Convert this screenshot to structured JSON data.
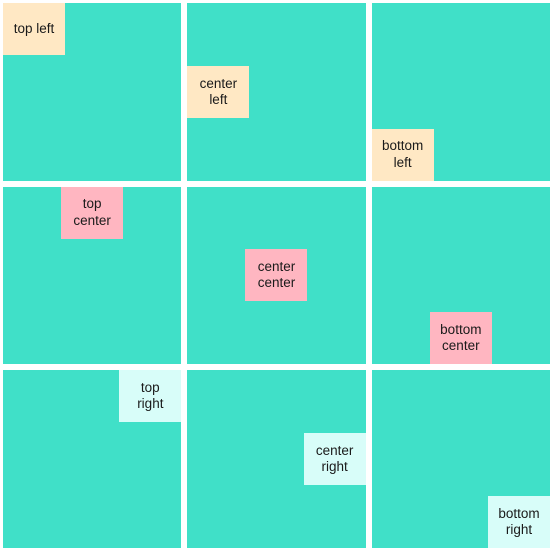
{
  "colors": {
    "grid_bg": "#40e0c8",
    "cream": "#ffe8c4",
    "pink": "#ffb6c1",
    "mint": "#d8fdf9"
  },
  "cells": [
    {
      "label": "top left",
      "color": "cream",
      "align": "c1"
    },
    {
      "label": "center\nleft",
      "color": "cream",
      "align": "c2"
    },
    {
      "label": "bottom\nleft",
      "color": "cream",
      "align": "c3"
    },
    {
      "label": "top\ncenter",
      "color": "pink",
      "align": "c4"
    },
    {
      "label": "center\ncenter",
      "color": "pink",
      "align": "c5"
    },
    {
      "label": "bottom\ncenter",
      "color": "pink",
      "align": "c6"
    },
    {
      "label": "top\nright",
      "color": "mint",
      "align": "c7"
    },
    {
      "label": "center\nright",
      "color": "mint",
      "align": "c8"
    },
    {
      "label": "bottom\nright",
      "color": "mint",
      "align": "c9"
    }
  ]
}
